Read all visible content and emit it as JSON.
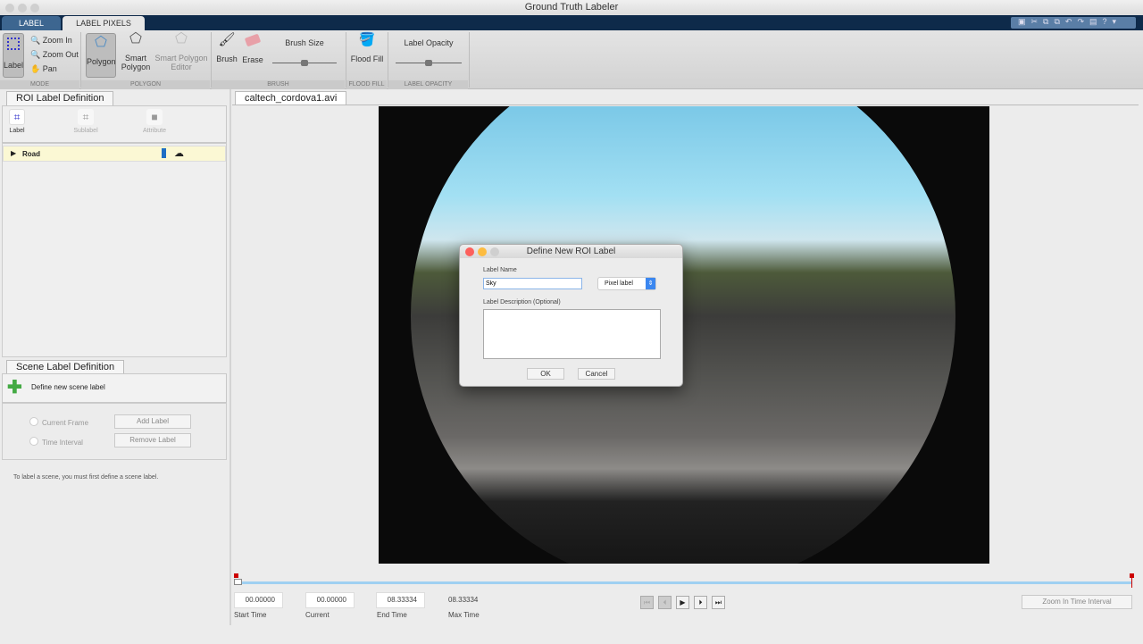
{
  "window": {
    "title": "Ground Truth Labeler"
  },
  "tabs": [
    {
      "label": "LABEL"
    },
    {
      "label": "LABEL PIXELS"
    }
  ],
  "ribbon": {
    "mode": {
      "label": "Label",
      "zoom_in": "Zoom In",
      "zoom_out": "Zoom Out",
      "pan": "Pan",
      "group": "MODE"
    },
    "polygon": {
      "polygon": "Polygon",
      "smart_polygon": "Smart Polygon",
      "smart_polygon_editor": "Smart Polygon Editor",
      "group": "POLYGON"
    },
    "brush": {
      "brush": "Brush",
      "erase": "Erase",
      "brush_size": "Brush Size",
      "brush_size_value": 0.5,
      "group": "BRUSH"
    },
    "flood_fill": {
      "label": "Flood Fill",
      "group": "FLOOD FILL"
    },
    "opacity": {
      "label": "Label Opacity",
      "value": 0.5,
      "group": "LABEL OPACITY"
    }
  },
  "roi_panel": {
    "title": "ROI Label Definition",
    "buttons": [
      "Label",
      "Sublabel",
      "Attribute"
    ],
    "labels": [
      {
        "name": "Road",
        "color": "#1f6fc4"
      }
    ]
  },
  "scene_panel": {
    "title": "Scene Label Definition",
    "define": "Define new scene label",
    "current_frame": "Current Frame",
    "time_interval": "Time Interval",
    "add": "Add Label",
    "remove": "Remove Label",
    "hint": "To label a scene, you must first define a scene label."
  },
  "video": {
    "tab": "caltech_cordova1.avi"
  },
  "dialog": {
    "title": "Define New ROI Label",
    "name_label": "Label Name",
    "name_value": "Sky",
    "type": "Pixel label",
    "desc_label": "Label Description (Optional)",
    "ok": "OK",
    "cancel": "Cancel"
  },
  "timeline": {
    "start": "00.00000",
    "start_label": "Start Time",
    "current": "00.00000",
    "current_label": "Current",
    "end": "08.33334",
    "end_label": "End Time",
    "max": "08.33334",
    "max_label": "Max Time",
    "zoom_btn": "Zoom In Time Interval"
  }
}
